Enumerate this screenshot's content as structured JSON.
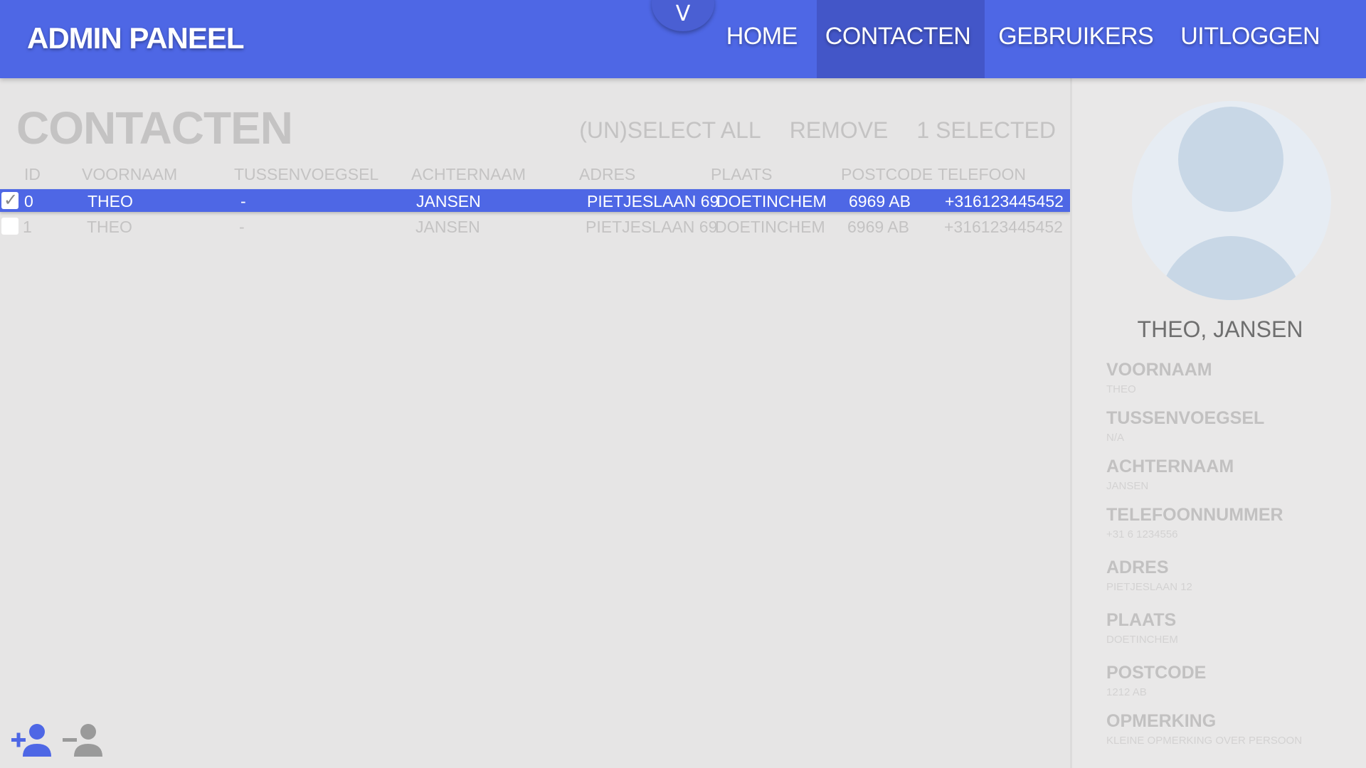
{
  "header": {
    "brand": "ADMIN PANEEL",
    "toggle_label": "V",
    "nav": [
      {
        "label": "HOME"
      },
      {
        "label": "CONTACTEN"
      },
      {
        "label": "GEBRUIKERS"
      },
      {
        "label": "UITLOGGEN"
      }
    ],
    "active_nav": "CONTACTEN",
    "accent_color": "#4e67e5"
  },
  "main": {
    "title": "CONTACTEN",
    "actions": {
      "select_all": "(UN)SELECT ALL",
      "remove": "REMOVE",
      "selected_count": "1 SELECTED"
    },
    "columns": [
      "ID",
      "VOORNAAM",
      "TUSSENVOEGSEL",
      "ACHTERNAAM",
      "ADRES",
      "PLAATS",
      "POSTCODE",
      "TELEFOON"
    ],
    "rows": [
      {
        "checked": true,
        "id": "0",
        "voornaam": "THEO",
        "tussenvoegsel": "-",
        "achternaam": "JANSEN",
        "adres": "PIETJESLAAN 69",
        "plaats": "DOETINCHEM",
        "postcode": "6969 AB",
        "telefoon": "+316123445452"
      },
      {
        "checked": false,
        "id": "1",
        "voornaam": "THEO",
        "tussenvoegsel": "-",
        "achternaam": "JANSEN",
        "adres": "PIETJESLAAN 69",
        "plaats": "DOETINCHEM",
        "postcode": "6969 AB",
        "telefoon": "+316123445452"
      }
    ],
    "bottom_icons": [
      "add-person-icon",
      "remove-person-icon"
    ]
  },
  "detail": {
    "name": "THEO, JANSEN",
    "fields": [
      {
        "label": "VOORNAAM",
        "value": "THEO"
      },
      {
        "label": "TUSSENVOEGSEL",
        "value": "N/A"
      },
      {
        "label": "ACHTERNAAM",
        "value": "JANSEN"
      },
      {
        "label": "TELEFOONNUMMER",
        "value": "+31 6 1234556"
      },
      {
        "label": "ADRES",
        "value": "PIETJESLAAN 12"
      },
      {
        "label": "PLAATS",
        "value": "DOETINCHEM"
      },
      {
        "label": "POSTCODE",
        "value": "1212 AB"
      },
      {
        "label": "OPMERKING",
        "value": "KLEINE OPMERKING OVER PERSOON"
      }
    ]
  }
}
